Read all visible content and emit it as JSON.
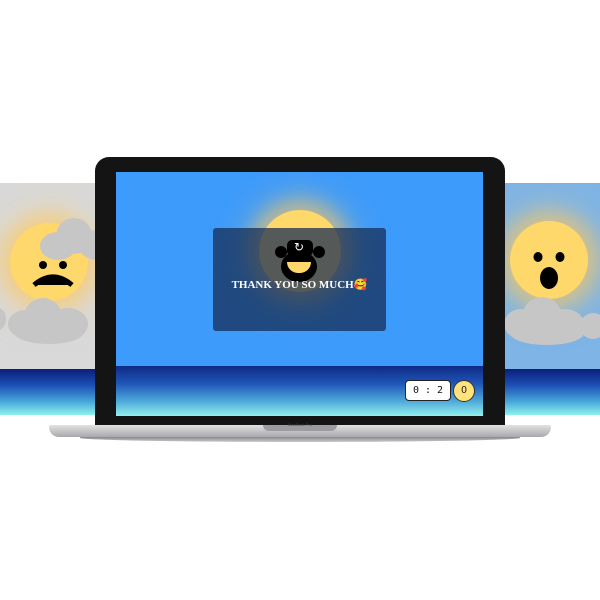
{
  "game": {
    "message": "THANK YOU SO MUCH🥰",
    "score_display": "0 : 2",
    "coin_count": "0",
    "device_label": "MacBook Pro"
  },
  "icons": {
    "refresh": "↻"
  },
  "scenes": {
    "left": {
      "weather": "cloudy",
      "sun_mood": "sad"
    },
    "center": {
      "weather": "clear",
      "sun_mood": "happy"
    },
    "right": {
      "weather": "cloudy",
      "sun_mood": "surprised"
    }
  },
  "colors": {
    "sky_center": "#3d9bfb",
    "sky_left": "#d9d9d9",
    "sky_right": "#7eb4e6",
    "sun": "#ffd86b",
    "modal_bg": "#142a50",
    "coin": "#ffe27a"
  }
}
